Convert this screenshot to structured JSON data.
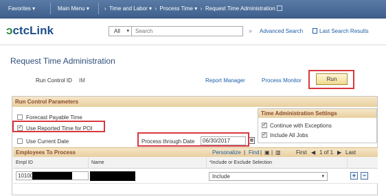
{
  "nav": {
    "favorites": "Favorites",
    "main_menu": "Main Menu",
    "breadcrumbs": [
      "Time and Labor",
      "Process Time",
      "Request Time Administration"
    ]
  },
  "header": {
    "logo": "ctcLink",
    "search_category": "All",
    "search_placeholder": "Search",
    "advanced_search": "Advanced Search",
    "last_search_results": "Last Search Results"
  },
  "page": {
    "title": "Request Time Administration",
    "run_control_label": "Run Control ID",
    "run_control_value": "IM",
    "report_manager": "Report Manager",
    "process_monitor": "Process Monitor",
    "run_button": "Run"
  },
  "params": {
    "title": "Run Control Parameters",
    "forecast_payable": {
      "label": "Forecast Payable Time",
      "checked": false
    },
    "use_reported": {
      "label": "Use Reported Time for POI",
      "checked": true
    },
    "use_current_date": {
      "label": "Use Current Date",
      "checked": false
    },
    "process_through_label": "Process through Date",
    "process_through_value": "06/30/2017"
  },
  "tas": {
    "title": "Time Administration Settings",
    "continue_exceptions": {
      "label": "Continue with Exceptions",
      "checked": true
    },
    "include_all_jobs": {
      "label": "Include All Jobs",
      "checked": true
    }
  },
  "employees": {
    "title": "Employees To Process",
    "personalize": "Personalize",
    "find": "Find",
    "pagination": "1 of 1",
    "first": "First",
    "last": "Last",
    "columns": [
      "Empl ID",
      "Name",
      "*Include or Exclude Selection"
    ],
    "rows": [
      {
        "emplid": "10100",
        "selection": "Include"
      }
    ]
  }
}
